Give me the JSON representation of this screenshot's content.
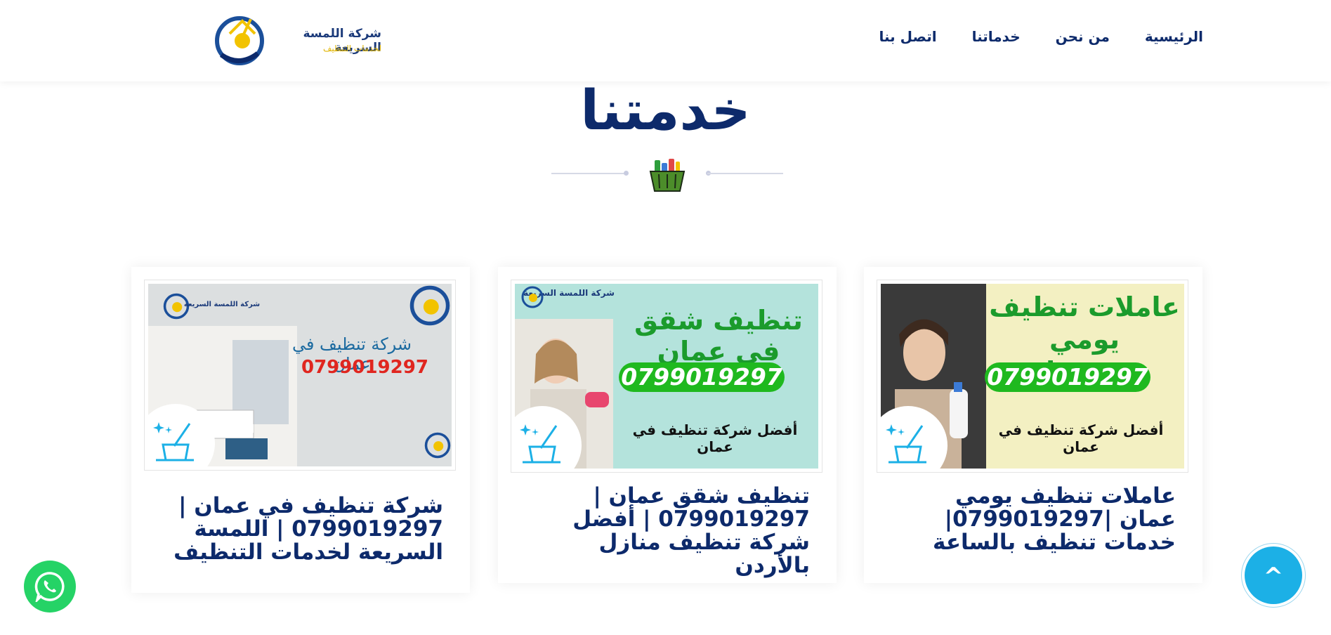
{
  "header": {
    "logo_title": "شركة اللمسة السريعة",
    "logo_subtitle": "لخدمات التنظيف",
    "nav": [
      {
        "label": "الرئيسية"
      },
      {
        "label": "من نحن"
      },
      {
        "label": "خدماتنا"
      },
      {
        "label": "اتصل بنا"
      }
    ]
  },
  "section": {
    "title": "خدمتنا"
  },
  "cards": [
    {
      "title": "عاملات تنظيف يومي عمان |0799019297| خدمات تنظيف بالساعة",
      "image": {
        "headline_line1": "عاملات تنظيف يومي",
        "headline_line2": "في عمان",
        "phone": "0799019297",
        "tagline": "أفضل شركة تنظيف في عمان",
        "bg": "#f3f0c2"
      }
    },
    {
      "title": "تنظيف شقق عمان | 0799019297 | أفضل شركة تنظيف منازل بالأردن",
      "image": {
        "brand": "شركة اللمسة السريعة",
        "headline": "تنظيف شقق في عمان",
        "phone": "0799019297",
        "tagline": "أفضل شركة تنظيف في عمان",
        "bg": "#b4e3dc"
      }
    },
    {
      "title": "شركة تنظيف في عمان | 0799019297 | اللمسة السريعة لخدمات التنظيف",
      "image": {
        "brand": "شركة اللمسة السريعة",
        "headline": "شركة تنظيف في عمان",
        "phone": "0799019297",
        "bg": "#dcdfe0"
      }
    }
  ],
  "colors": {
    "navy": "#0d2a6b",
    "accent_blue": "#1cb0e6",
    "whatsapp_green": "#25d366",
    "logo_yellow": "#f2c300"
  },
  "floating": {
    "to_top_label": "^"
  }
}
